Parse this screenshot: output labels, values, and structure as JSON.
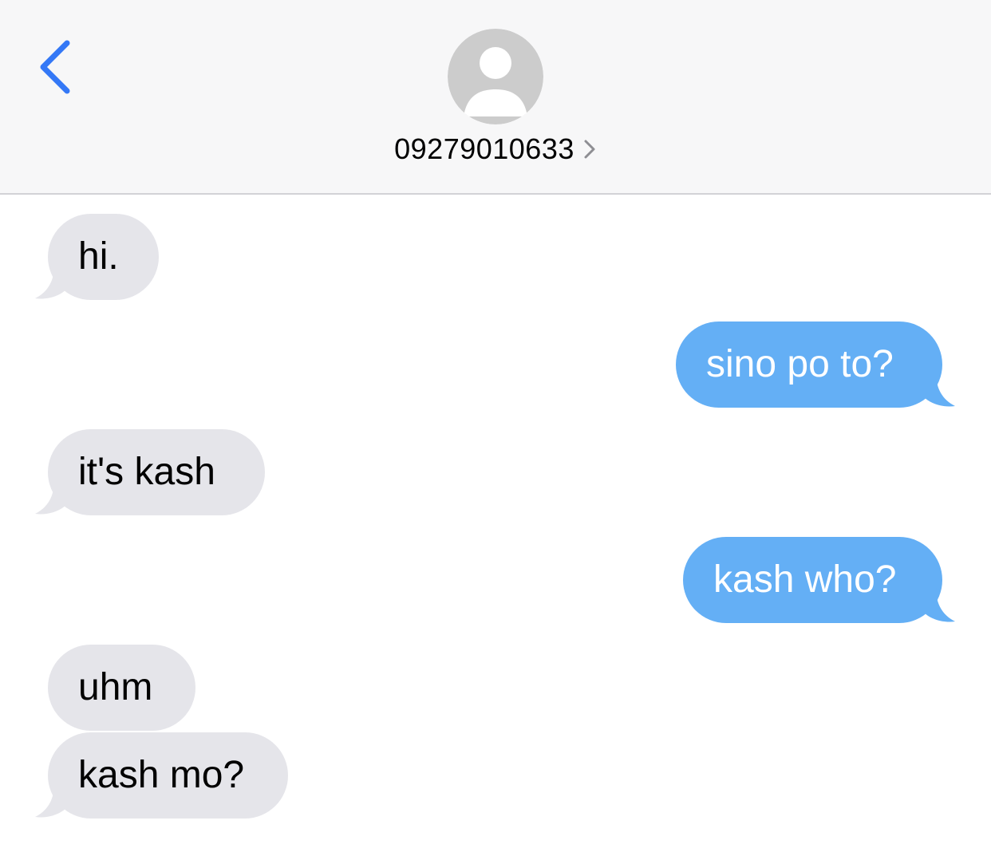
{
  "header": {
    "contact_number": "09279010633",
    "accent_color": "#3478f6",
    "icons": [
      "back-chevron-icon",
      "person-icon",
      "chevron-right-icon"
    ]
  },
  "messages": [
    {
      "direction": "incoming",
      "text": "hi."
    },
    {
      "direction": "outgoing",
      "text": "sino po to?"
    },
    {
      "direction": "incoming",
      "text": "it's kash"
    },
    {
      "direction": "outgoing",
      "text": "kash who?"
    },
    {
      "direction": "incoming",
      "text": "uhm"
    },
    {
      "direction": "incoming",
      "text": "kash mo?"
    }
  ],
  "colors": {
    "incoming_bubble": "#e5e5ea",
    "outgoing_bubble": "#64aff5",
    "header_background": "#f7f7f8",
    "avatar_background": "#cccccc"
  }
}
